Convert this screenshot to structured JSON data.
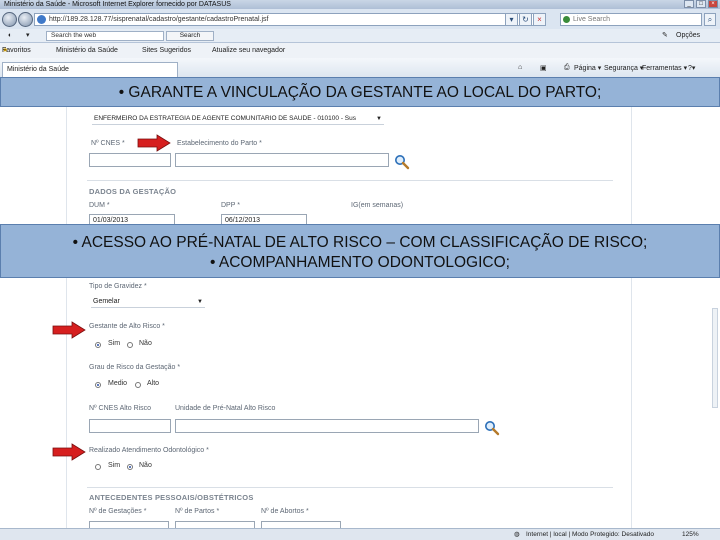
{
  "window": {
    "title": "Ministério da Saúde - Microsoft Internet Explorer fornecido por DATASUS"
  },
  "addressbar": {
    "url": "http://189.28.128.77/sisprenatal/cadastro/gestante/cadastroPrenatal.jsf",
    "search_placeholder": "Live Search"
  },
  "toolbar": {
    "search_value": "Search the web",
    "search_button": "Search"
  },
  "favorites": {
    "favoritos": "Favoritos",
    "items": [
      "Ministério da Saúde",
      "Sites Sugeridos",
      "Atualize seu navegador"
    ]
  },
  "tab": {
    "label": "Ministério da Saúde"
  },
  "commands": {
    "pagina": "Página",
    "seguranca": "Segurança",
    "ferramentas": "Ferramentas",
    "opcoes": "Opções"
  },
  "form": {
    "equipe_value": "ENFERMEIRO DA ESTRATEGIA DE AGENTE COMUNITARIO DE SAUDE - 010100 - Sus",
    "cnes_label": "Nº CNES *",
    "estab_parto_label": "Estabelecimento do Parto *",
    "dados_gestacao_title": "DADOS DA GESTAÇÃO",
    "dum_label": "DUM *",
    "dpp_label": "DPP *",
    "ig_label": "IG(em semanas)",
    "dum_value": "01/03/2013",
    "dpp_value": "06/12/2013",
    "tipo_gravidez_label": "Tipo de Gravidez *",
    "tipo_gravidez_value": "Gemelar",
    "alto_risco_label": "Gestante de Alto Risco *",
    "sim": "Sim",
    "nao": "Não",
    "grau_risco_label": "Grau de Risco da Gestação *",
    "medio": "Medio",
    "alto": "Alto",
    "cnes_alto_risco_label": "Nº CNES Alto Risco",
    "unidade_alto_risco_label": "Unidade de Pré-Natal Alto Risco",
    "odonto_label": "Realizado Atendimento Odontológico *",
    "antecedentes_title": "ANTECEDENTES PESSOAIS/OBSTÉTRICOS",
    "gestacoes_label": "Nº de Gestações *",
    "partos_label": "Nº de Partos *",
    "abortos_label": "Nº de Abortos *"
  },
  "statusbar": {
    "zone": "Internet | local | Modo Protegido: Desativado",
    "zoom": "125%"
  },
  "banners": {
    "line1": "• GARANTE A VINCULAÇÃO DA GESTANTE AO LOCAL DO PARTO;",
    "line2": "• ACESSO AO PRÉ-NATAL DE ALTO RISCO – COM CLASSIFICAÇÃO DE RISCO;",
    "line3": "• ACOMPANHAMENTO ODONTOLOGICO;"
  },
  "colors": {
    "banner_bg": "#95b3d7",
    "arrow_red": "#d61f1f",
    "chrome_blue": "#dbe5f1"
  },
  "icons": [
    "ie-logo-icon",
    "back-icon",
    "forward-icon",
    "refresh-icon",
    "stop-icon",
    "search-icon",
    "favorites-star-icon",
    "red-arrow-icon",
    "magnifier-icon"
  ]
}
